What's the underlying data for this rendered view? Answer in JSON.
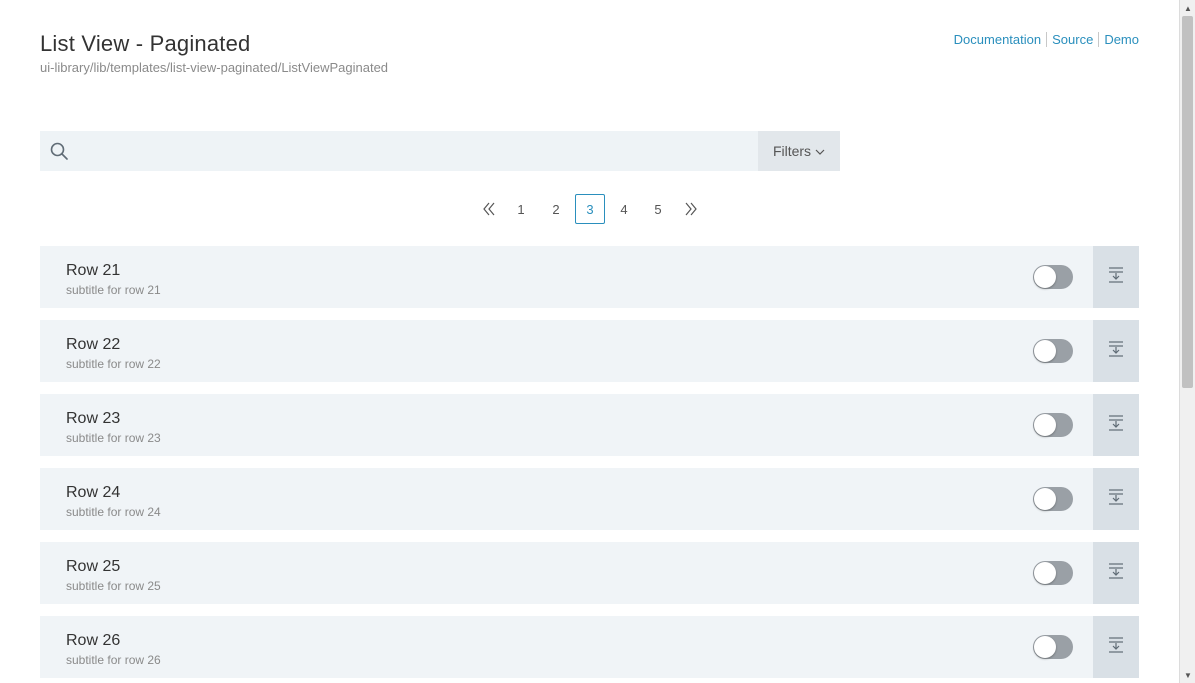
{
  "header": {
    "title": "List View - Paginated",
    "path": "ui-library/lib/templates/list-view-paginated/ListViewPaginated",
    "links": [
      "Documentation",
      "Source",
      "Demo"
    ]
  },
  "search": {
    "placeholder": "",
    "value": "",
    "filters_label": "Filters"
  },
  "pagination": {
    "first_icon": "double-chevron-left-icon",
    "last_icon": "double-chevron-right-icon",
    "pages": [
      "1",
      "2",
      "3",
      "4",
      "5"
    ],
    "current": "3"
  },
  "rows": [
    {
      "title": "Row 21",
      "subtitle": "subtitle for row 21",
      "toggle": false
    },
    {
      "title": "Row 22",
      "subtitle": "subtitle for row 22",
      "toggle": false
    },
    {
      "title": "Row 23",
      "subtitle": "subtitle for row 23",
      "toggle": false
    },
    {
      "title": "Row 24",
      "subtitle": "subtitle for row 24",
      "toggle": false
    },
    {
      "title": "Row 25",
      "subtitle": "subtitle for row 25",
      "toggle": false
    },
    {
      "title": "Row 26",
      "subtitle": "subtitle for row 26",
      "toggle": false
    }
  ],
  "colors": {
    "accent": "#2a8fbd",
    "row_bg": "#f0f4f7",
    "action_bg": "#d9e0e6",
    "toggle_off": "#9aa0a6"
  }
}
